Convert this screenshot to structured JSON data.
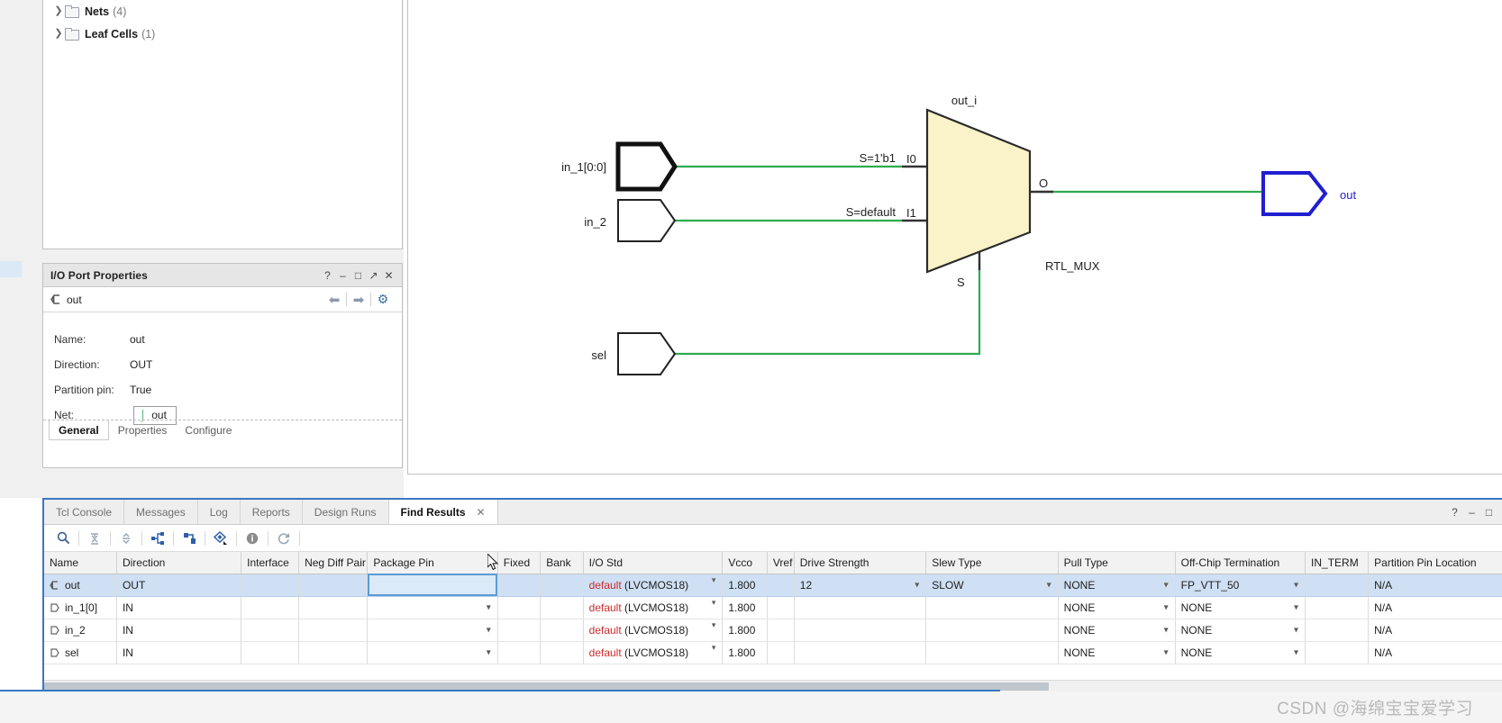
{
  "netlist": {
    "items": [
      {
        "label": "Nets",
        "count": "(4)"
      },
      {
        "label": "Leaf Cells",
        "count": "(1)"
      }
    ]
  },
  "io_panel": {
    "title": "I/O Port Properties",
    "titlebar_buttons": [
      "?",
      "–",
      "□",
      "↗",
      "✕"
    ],
    "selected_port": "out",
    "nav_back": "⬅",
    "nav_forward": "➡",
    "settings_icon": "gear-icon",
    "properties": [
      {
        "key": "Name:",
        "value": "out"
      },
      {
        "key": "Direction:",
        "value": "OUT"
      },
      {
        "key": "Partition pin:",
        "value": "True"
      }
    ],
    "net_key": "Net:",
    "net_value": "out",
    "tabs": [
      {
        "label": "General",
        "active": true
      },
      {
        "label": "Properties",
        "active": false
      },
      {
        "label": "Configure",
        "active": false
      }
    ]
  },
  "schematic": {
    "cell_label": "out_i",
    "cell_type": "RTL_MUX",
    "mux_fill": "#faf2c8",
    "wire_color": "#2eab4f",
    "ports": [
      {
        "name": "in_1[0:0]",
        "kind": "input",
        "emphasis": "bold"
      },
      {
        "name": "in_2",
        "kind": "input",
        "emphasis": "normal"
      },
      {
        "name": "sel",
        "kind": "input",
        "emphasis": "normal"
      },
      {
        "name": "out",
        "kind": "output",
        "emphasis": "selected",
        "color": "#2222cc"
      }
    ],
    "pin_labels": [
      {
        "text": "S=1'b1",
        "pin": "I0"
      },
      {
        "text": "S=default",
        "pin": "I1"
      }
    ],
    "out_pin": "O",
    "sel_pin": "S"
  },
  "bottom_panel": {
    "tabs": [
      {
        "label": "Tcl Console",
        "active": false
      },
      {
        "label": "Messages",
        "active": false
      },
      {
        "label": "Log",
        "active": false
      },
      {
        "label": "Reports",
        "active": false
      },
      {
        "label": "Design Runs",
        "active": false
      },
      {
        "label": "Find Results",
        "active": true,
        "closable": true
      }
    ],
    "tab_close": "✕",
    "titlebar_buttons": [
      "?",
      "–",
      "□"
    ],
    "toolbar_icons": [
      "search-icon",
      "collapse-all-icon",
      "expand-all-icon",
      "schematic-icon",
      "hierarchy-icon",
      "highlight-icon",
      "info-icon",
      "refresh-icon"
    ],
    "columns": [
      "Name",
      "Direction",
      "Interface",
      "Neg Diff Pair",
      "Package Pin",
      "Fixed",
      "Bank",
      "I/O Std",
      "Vcco",
      "Vref",
      "Drive Strength",
      "Slew Type",
      "Pull Type",
      "Off-Chip Termination",
      "IN_TERM",
      "Partition Pin Location"
    ],
    "rows": [
      {
        "name": "out",
        "icon": "output-port-icon",
        "selected": true,
        "direction": "OUT",
        "interface": "",
        "neg_diff_pair": "",
        "package_pin": "",
        "package_pin_focused": true,
        "fixed": "",
        "bank": "",
        "io_std_default": "default",
        "io_std_value": "(LVCMOS18)",
        "vcco": "1.800",
        "vref": "",
        "drive_strength": "12",
        "slew_type": "SLOW",
        "pull_type": "NONE",
        "off_chip_termination": "FP_VTT_50",
        "in_term": "",
        "partition_pin_location": "N/A"
      },
      {
        "name": "in_1[0]",
        "icon": "input-port-icon",
        "selected": false,
        "direction": "IN",
        "interface": "",
        "neg_diff_pair": "",
        "package_pin": "",
        "package_pin_focused": false,
        "fixed": "",
        "bank": "",
        "io_std_default": "default",
        "io_std_value": "(LVCMOS18)",
        "vcco": "1.800",
        "vref": "",
        "drive_strength": "",
        "slew_type": "",
        "pull_type": "NONE",
        "off_chip_termination": "NONE",
        "in_term": "",
        "partition_pin_location": "N/A"
      },
      {
        "name": "in_2",
        "icon": "input-port-icon",
        "selected": false,
        "direction": "IN",
        "interface": "",
        "neg_diff_pair": "",
        "package_pin": "",
        "package_pin_focused": false,
        "fixed": "",
        "bank": "",
        "io_std_default": "default",
        "io_std_value": "(LVCMOS18)",
        "vcco": "1.800",
        "vref": "",
        "drive_strength": "",
        "slew_type": "",
        "pull_type": "NONE",
        "off_chip_termination": "NONE",
        "in_term": "",
        "partition_pin_location": "N/A"
      },
      {
        "name": "sel",
        "icon": "input-port-icon",
        "selected": false,
        "direction": "IN",
        "interface": "",
        "neg_diff_pair": "",
        "package_pin": "",
        "package_pin_focused": false,
        "fixed": "",
        "bank": "",
        "io_std_default": "default",
        "io_std_value": "(LVCMOS18)",
        "vcco": "1.800",
        "vref": "",
        "drive_strength": "",
        "slew_type": "",
        "pull_type": "NONE",
        "off_chip_termination": "NONE",
        "in_term": "",
        "partition_pin_location": "N/A"
      }
    ]
  },
  "footer": {
    "watermark": "CSDN @海绵宝宝爱学习"
  }
}
